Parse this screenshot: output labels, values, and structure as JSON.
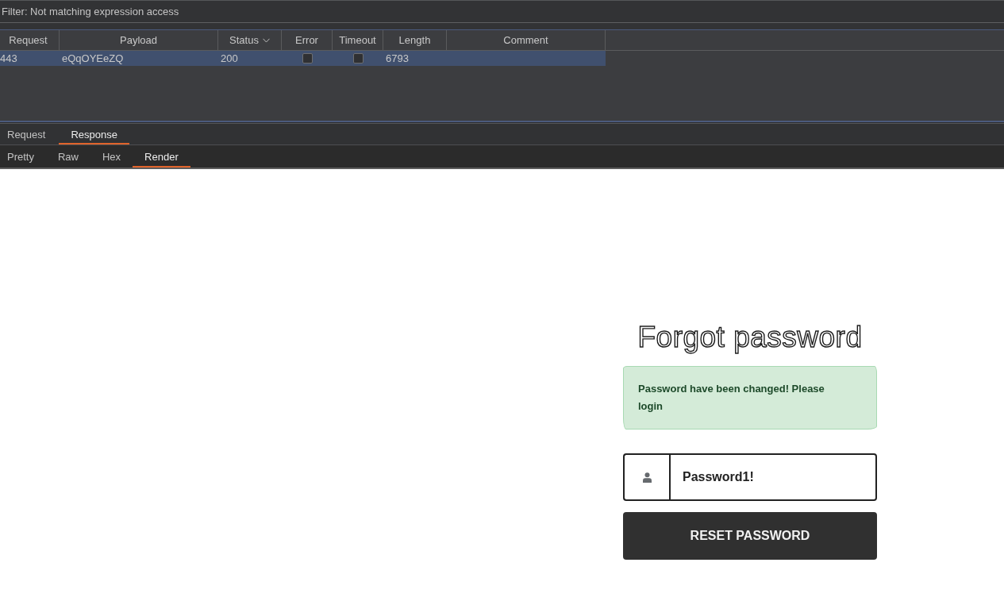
{
  "filter_bar": {
    "text": "Filter: Not matching expression access"
  },
  "results_table": {
    "columns": [
      {
        "label": "Request",
        "sorted": false
      },
      {
        "label": "Payload",
        "sorted": false
      },
      {
        "label": "Status",
        "sorted": true
      },
      {
        "label": "Error",
        "sorted": false
      },
      {
        "label": "Timeout",
        "sorted": false
      },
      {
        "label": "Length",
        "sorted": false
      },
      {
        "label": "Comment",
        "sorted": false
      }
    ],
    "rows": [
      {
        "selected": true,
        "cells": [
          {
            "kind": "text",
            "text": "443"
          },
          {
            "kind": "text",
            "text": "eQqOYEeZQ"
          },
          {
            "kind": "text",
            "text": "200"
          },
          {
            "kind": "checkbox",
            "checked": false
          },
          {
            "kind": "checkbox",
            "checked": false
          },
          {
            "kind": "text",
            "text": "6793"
          }
        ]
      }
    ]
  },
  "message_tabs": [
    {
      "label": "Request",
      "selected": false
    },
    {
      "label": "Response",
      "selected": true
    }
  ],
  "view_tabs": [
    {
      "label": "Pretty",
      "selected": false
    },
    {
      "label": "Raw",
      "selected": false
    },
    {
      "label": "Hex",
      "selected": false
    },
    {
      "label": "Render",
      "selected": true
    }
  ],
  "rendered_page": {
    "title": "Forgot password",
    "alert": {
      "text": "Password have been changed! Please login"
    },
    "password_field": {
      "value": "Password1!"
    },
    "submit_button": {
      "label": "RESET PASSWORD"
    }
  }
}
